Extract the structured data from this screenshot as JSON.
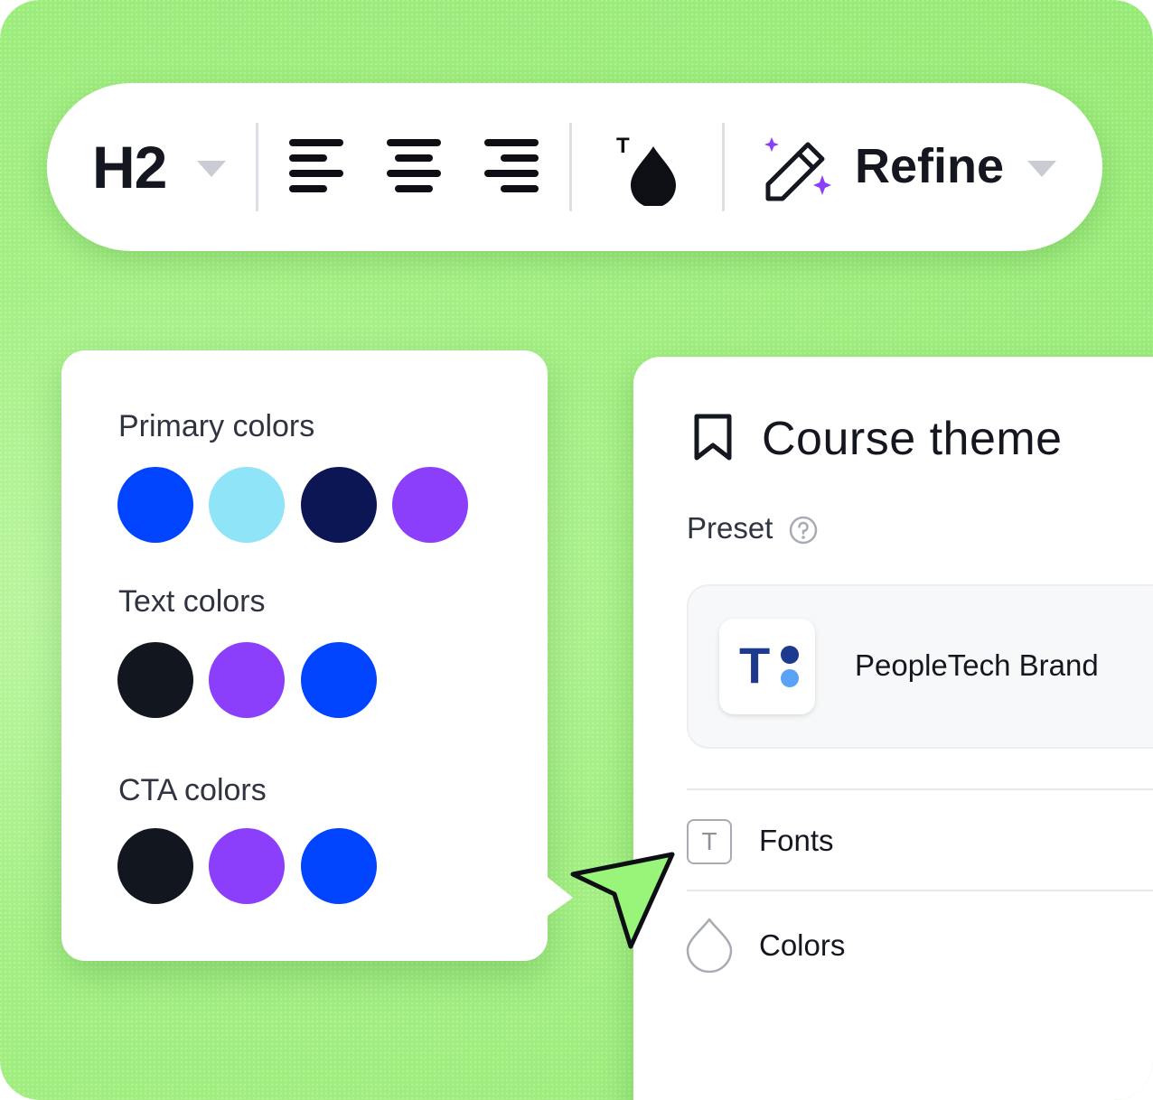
{
  "toolbar": {
    "heading_style": "H2",
    "refine_label": "Refine",
    "icons": [
      "align-left-icon",
      "align-center-icon",
      "align-right-icon",
      "text-color-icon",
      "magic-pen-icon"
    ]
  },
  "color_panel": {
    "sections": [
      {
        "title": "Primary colors",
        "colors": [
          "#0044ff",
          "#8fe4f8",
          "#0d1654",
          "#8c3ffb"
        ]
      },
      {
        "title": "Text colors",
        "colors": [
          "#11161f",
          "#8c3ffb",
          "#0044ff"
        ]
      },
      {
        "title": "CTA colors",
        "colors": [
          "#11161f",
          "#8c3ffb",
          "#0044ff"
        ]
      }
    ]
  },
  "course_theme": {
    "title": "Course theme",
    "preset_label": "Preset",
    "preset_name": "PeopleTech Brand",
    "logo_letter": "T",
    "menu": [
      {
        "label": "Fonts",
        "icon": "font-icon"
      },
      {
        "label": "Colors",
        "icon": "droplet-icon"
      }
    ]
  },
  "colors": {
    "background": "#a3ef82",
    "cursor_fill": "#98f57a",
    "sparkle": "#8c3ffb",
    "logo_dark": "#1d3a8f",
    "logo_light": "#5aa2f5"
  }
}
